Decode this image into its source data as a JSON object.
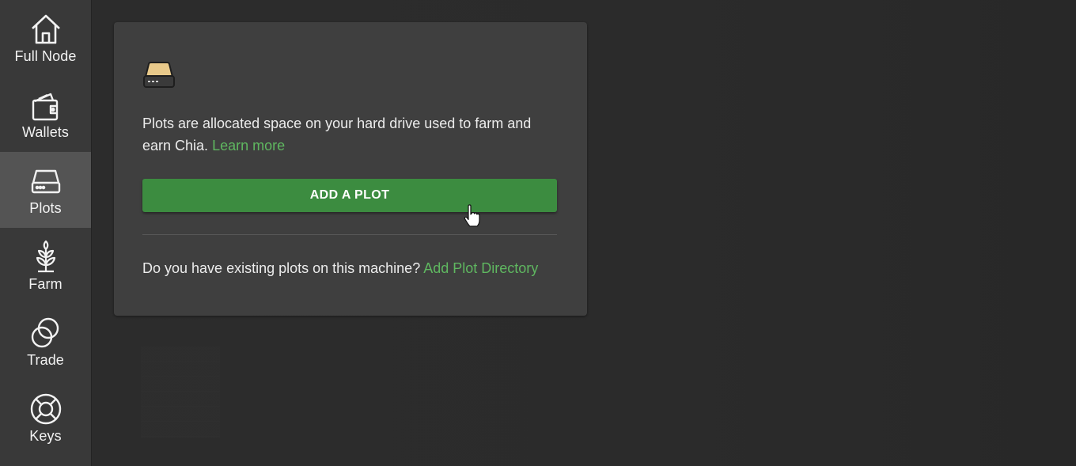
{
  "sidebar": {
    "items": [
      {
        "label": "Full Node",
        "icon": "home-icon",
        "active": false
      },
      {
        "label": "Wallets",
        "icon": "wallet-icon",
        "active": false
      },
      {
        "label": "Plots",
        "icon": "hard-drive-icon",
        "active": true
      },
      {
        "label": "Farm",
        "icon": "plant-icon",
        "active": false
      },
      {
        "label": "Trade",
        "icon": "trade-icon",
        "active": false
      },
      {
        "label": "Keys",
        "icon": "lifebuoy-icon",
        "active": false
      }
    ]
  },
  "plots_card": {
    "icon": "hard-drive-icon",
    "description": "Plots are allocated space on your hard drive used to farm and earn Chia.",
    "learn_more": "Learn more",
    "add_plot_button": "ADD A PLOT",
    "existing_question": "Do you have existing plots on this machine?",
    "add_directory_link": "Add Plot Directory"
  },
  "colors": {
    "accent_green": "#3c8c40",
    "link_green": "#5fb760",
    "sidebar_bg": "#393939",
    "sidebar_active_bg": "#545454",
    "card_bg": "#3f3f3f",
    "page_bg": "#2a2a2a"
  }
}
